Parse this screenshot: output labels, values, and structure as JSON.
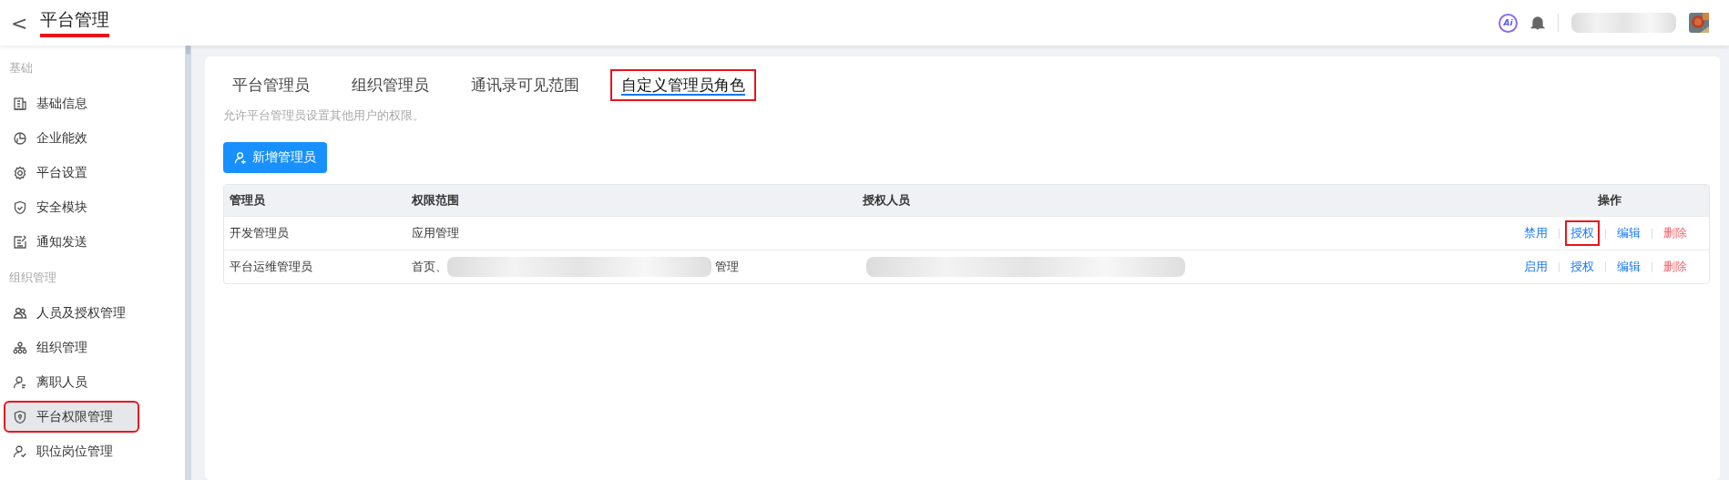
{
  "header": {
    "back": "<",
    "title": "平台管理",
    "title_highlighted": true,
    "ai_badge": "Ai"
  },
  "sidebar": {
    "sections": [
      {
        "label": "基础",
        "items": [
          {
            "label": "基础信息",
            "selected": false,
            "highlighted": false
          },
          {
            "label": "企业能效",
            "selected": false,
            "highlighted": false
          },
          {
            "label": "平台设置",
            "selected": false,
            "highlighted": false
          },
          {
            "label": "安全模块",
            "selected": false,
            "highlighted": false
          },
          {
            "label": "通知发送",
            "selected": false,
            "highlighted": false
          }
        ]
      },
      {
        "label": "组织管理",
        "items": [
          {
            "label": "人员及授权管理",
            "selected": false,
            "highlighted": false
          },
          {
            "label": "组织管理",
            "selected": false,
            "highlighted": false
          },
          {
            "label": "离职人员",
            "selected": false,
            "highlighted": false
          },
          {
            "label": "平台权限管理",
            "selected": true,
            "highlighted": true
          },
          {
            "label": "职位岗位管理",
            "selected": false,
            "highlighted": false
          }
        ]
      }
    ]
  },
  "tabs": [
    {
      "label": "平台管理员",
      "selected": false,
      "highlighted": false
    },
    {
      "label": "组织管理员",
      "selected": false,
      "highlighted": false
    },
    {
      "label": "通讯录可见范围",
      "selected": false,
      "highlighted": false
    },
    {
      "label": "自定义管理员角色",
      "selected": true,
      "highlighted": true
    }
  ],
  "description": "允许平台管理员设置其他用户的权限。",
  "add_button": "新增管理员",
  "table": {
    "columns": [
      "管理员",
      "权限范围",
      "授权人员",
      "操作"
    ],
    "rows": [
      {
        "admin": "开发管理员",
        "scope": [
          "应用管理"
        ],
        "scope_redacted": false,
        "people_redacted": false,
        "actions": [
          {
            "kind": "toggle",
            "label": "禁用",
            "highlighted": false
          },
          {
            "kind": "grant",
            "label": "授权",
            "highlighted": true
          },
          {
            "kind": "edit",
            "label": "编辑",
            "highlighted": false
          },
          {
            "kind": "delete",
            "label": "删除",
            "highlighted": false
          }
        ]
      },
      {
        "admin": "平台运维管理员",
        "scope": [
          "首页、",
          "管理"
        ],
        "scope_redacted": true,
        "people_redacted": true,
        "actions": [
          {
            "kind": "toggle",
            "label": "启用",
            "highlighted": false
          },
          {
            "kind": "grant",
            "label": "授权",
            "highlighted": false
          },
          {
            "kind": "edit",
            "label": "编辑",
            "highlighted": false
          },
          {
            "kind": "delete",
            "label": "删除",
            "highlighted": false
          }
        ]
      }
    ]
  }
}
